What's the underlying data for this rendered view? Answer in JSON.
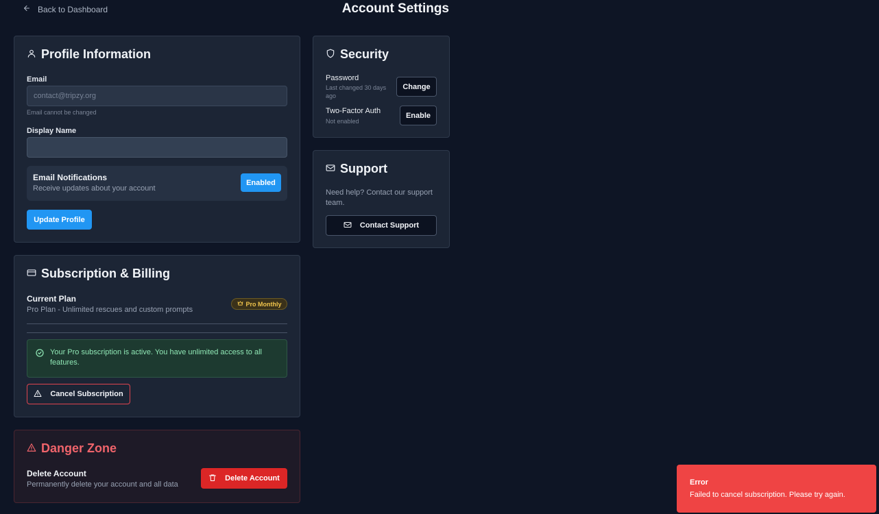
{
  "nav": {
    "back_label": "Back to Dashboard",
    "page_title": "Account Settings"
  },
  "profile": {
    "title": "Profile Information",
    "email_label": "Email",
    "email_value": "contact@tripzy.org",
    "email_hint": "Email cannot be changed",
    "display_name_label": "Display Name",
    "display_name_value": "",
    "notifications_title": "Email Notifications",
    "notifications_sub": "Receive updates about your account",
    "notifications_toggle": "Enabled",
    "update_button": "Update Profile"
  },
  "subscription": {
    "title": "Subscription & Billing",
    "plan_label": "Current Plan",
    "plan_desc": "Pro Plan - Unlimited rescues and custom prompts",
    "plan_badge": "Pro Monthly",
    "status_message": "Your Pro subscription is active. You have unlimited access to all features.",
    "cancel_button": "Cancel Subscription"
  },
  "danger": {
    "title": "Danger Zone",
    "delete_label": "Delete Account",
    "delete_desc": "Permanently delete your account and all data",
    "delete_button": "Delete Account"
  },
  "security": {
    "title": "Security",
    "password_label": "Password",
    "password_sub": "Last changed 30 days ago",
    "password_button": "Change",
    "twofa_label": "Two-Factor Auth",
    "twofa_sub": "Not enabled",
    "twofa_button": "Enable"
  },
  "support": {
    "title": "Support",
    "text": "Need help? Contact our support team.",
    "button": "Contact Support"
  },
  "toast": {
    "title": "Error",
    "message": "Failed to cancel subscription. Please try again."
  },
  "colors": {
    "background": "#0e1525",
    "card": "#1c2535",
    "accent_blue": "#2196f3",
    "danger_red": "#dc2626",
    "toast_red": "#ef4444",
    "success_green": "#8fe6b4",
    "badge_gold": "#f0c44c"
  },
  "icons": {
    "back": "arrow-left-icon",
    "profile": "user-icon",
    "subscription": "credit-card-icon",
    "plan_badge": "crown-icon",
    "status": "check-circle-icon",
    "cancel": "alert-triangle-icon",
    "danger": "alert-triangle-icon",
    "delete": "trash-icon",
    "security": "shield-icon",
    "support": "mail-icon"
  }
}
